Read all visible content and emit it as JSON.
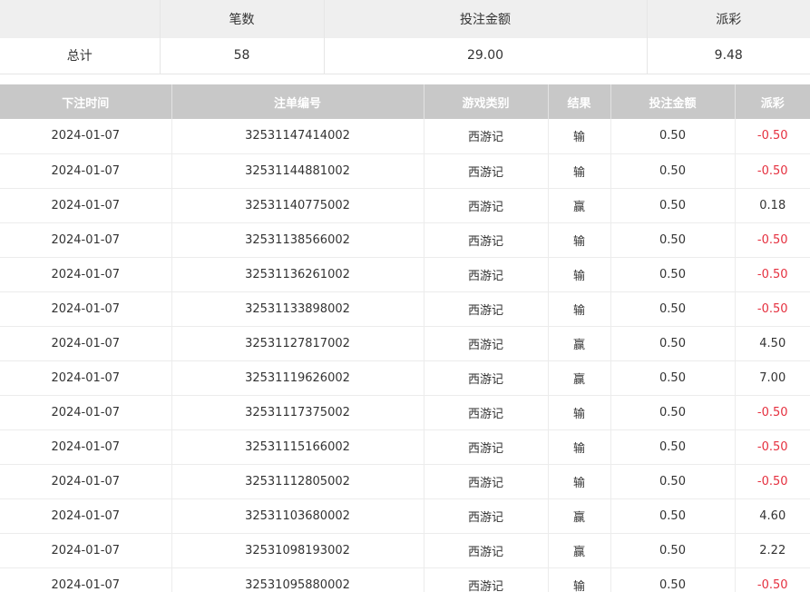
{
  "summary": {
    "headers": [
      "",
      "笔数",
      "投注金额",
      "派彩"
    ],
    "row": {
      "label": "总计",
      "count": "58",
      "bet_amount": "29.00",
      "payout": "9.48"
    }
  },
  "bets": {
    "headers": [
      "下注时间",
      "注单编号",
      "游戏类别",
      "结果",
      "投注金额",
      "派彩"
    ],
    "rows": [
      {
        "time": "2024-01-07",
        "id": "32531147414002",
        "game": "西游记",
        "result": "输",
        "amount": "0.50",
        "payout": "-0.50"
      },
      {
        "time": "2024-01-07",
        "id": "32531144881002",
        "game": "西游记",
        "result": "输",
        "amount": "0.50",
        "payout": "-0.50"
      },
      {
        "time": "2024-01-07",
        "id": "32531140775002",
        "game": "西游记",
        "result": "赢",
        "amount": "0.50",
        "payout": "0.18"
      },
      {
        "time": "2024-01-07",
        "id": "32531138566002",
        "game": "西游记",
        "result": "输",
        "amount": "0.50",
        "payout": "-0.50"
      },
      {
        "time": "2024-01-07",
        "id": "32531136261002",
        "game": "西游记",
        "result": "输",
        "amount": "0.50",
        "payout": "-0.50"
      },
      {
        "time": "2024-01-07",
        "id": "32531133898002",
        "game": "西游记",
        "result": "输",
        "amount": "0.50",
        "payout": "-0.50"
      },
      {
        "time": "2024-01-07",
        "id": "32531127817002",
        "game": "西游记",
        "result": "赢",
        "amount": "0.50",
        "payout": "4.50"
      },
      {
        "time": "2024-01-07",
        "id": "32531119626002",
        "game": "西游记",
        "result": "赢",
        "amount": "0.50",
        "payout": "7.00"
      },
      {
        "time": "2024-01-07",
        "id": "32531117375002",
        "game": "西游记",
        "result": "输",
        "amount": "0.50",
        "payout": "-0.50"
      },
      {
        "time": "2024-01-07",
        "id": "32531115166002",
        "game": "西游记",
        "result": "输",
        "amount": "0.50",
        "payout": "-0.50"
      },
      {
        "time": "2024-01-07",
        "id": "32531112805002",
        "game": "西游记",
        "result": "输",
        "amount": "0.50",
        "payout": "-0.50"
      },
      {
        "time": "2024-01-07",
        "id": "32531103680002",
        "game": "西游记",
        "result": "赢",
        "amount": "0.50",
        "payout": "4.60"
      },
      {
        "time": "2024-01-07",
        "id": "32531098193002",
        "game": "西游记",
        "result": "赢",
        "amount": "0.50",
        "payout": "2.22"
      },
      {
        "time": "2024-01-07",
        "id": "32531095880002",
        "game": "西游记",
        "result": "输",
        "amount": "0.50",
        "payout": "-0.50"
      }
    ]
  },
  "colors": {
    "negative": "#e5303f",
    "header_bg": "#c8c8c8",
    "summary_header_bg": "#efefef"
  }
}
